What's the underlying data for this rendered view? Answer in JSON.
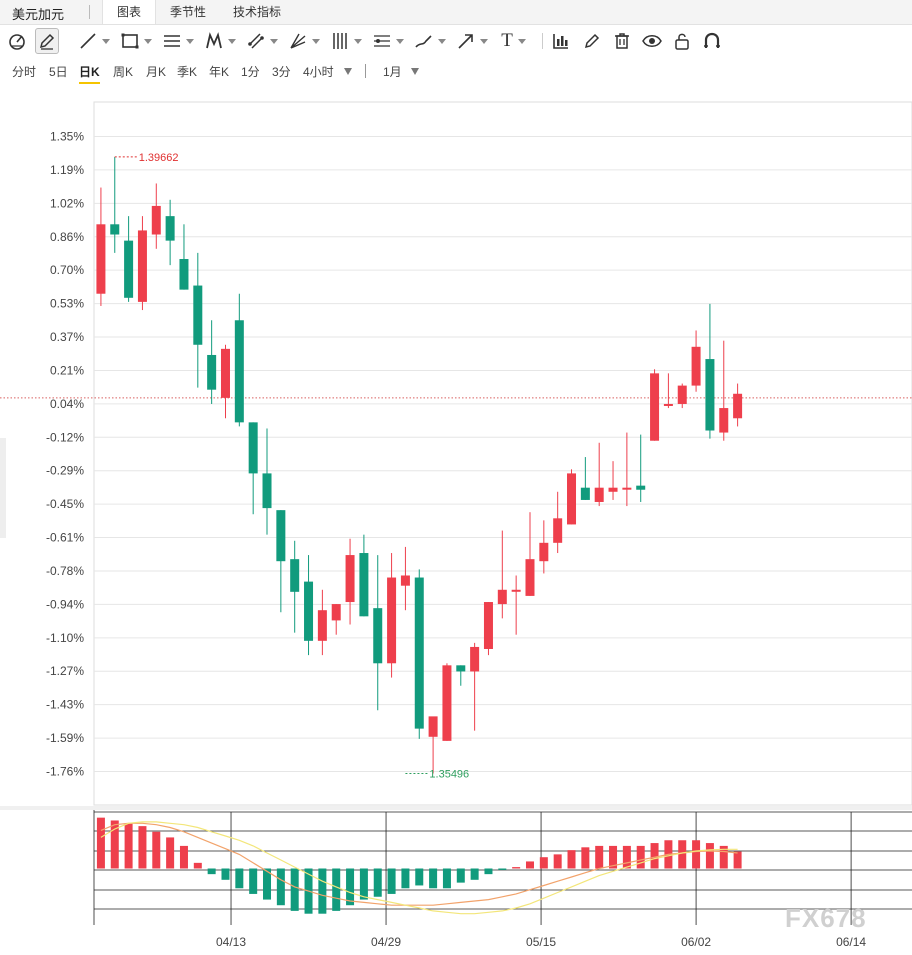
{
  "header": {
    "instrument": "美元加元",
    "tabs": [
      {
        "label": "图表",
        "active": true
      },
      {
        "label": "季节性",
        "active": false
      },
      {
        "label": "技术指标",
        "active": false
      }
    ]
  },
  "toolbar": {
    "tools": [
      {
        "icon": "cursor-icon",
        "dropdown": false
      },
      {
        "icon": "pencil-icon",
        "dropdown": false,
        "active": true
      },
      {
        "icon": "trend-line-icon",
        "dropdown": true
      },
      {
        "icon": "rectangle-icon",
        "dropdown": true
      },
      {
        "icon": "horizontal-lines-icon",
        "dropdown": true
      },
      {
        "icon": "pattern-icon",
        "dropdown": true
      },
      {
        "icon": "fib-channel-icon",
        "dropdown": true
      },
      {
        "icon": "gann-icon",
        "dropdown": true
      },
      {
        "icon": "vertical-lines-icon",
        "dropdown": true
      },
      {
        "icon": "ruler-icon",
        "dropdown": true
      },
      {
        "icon": "brush-icon",
        "dropdown": true
      },
      {
        "icon": "arrow-icon",
        "dropdown": true
      },
      {
        "icon": "text-icon",
        "dropdown": true
      },
      {
        "icon": "bar-chart-icon",
        "dropdown": false
      },
      {
        "icon": "edit-icon",
        "dropdown": false
      },
      {
        "icon": "trash-icon",
        "dropdown": false
      },
      {
        "icon": "eye-icon",
        "dropdown": false
      },
      {
        "icon": "lock-icon",
        "dropdown": false
      },
      {
        "icon": "magnet-icon",
        "dropdown": false
      }
    ],
    "text_tool_glyph": "T"
  },
  "periods": {
    "items": [
      {
        "label": "分时",
        "active": false
      },
      {
        "label": "5日",
        "active": false
      },
      {
        "label": "日K",
        "active": true
      },
      {
        "label": "周K",
        "active": false
      },
      {
        "label": "月K",
        "active": false
      },
      {
        "label": "季K",
        "active": false
      },
      {
        "label": "年K",
        "active": false
      },
      {
        "label": "1分",
        "active": false
      },
      {
        "label": "3分",
        "active": false
      },
      {
        "label": "4小时",
        "active": false
      }
    ],
    "range_label": "1月"
  },
  "watermark": "FX678",
  "colors": {
    "up": "#ee3f4c",
    "down": "#119b7d",
    "grid": "#e6e6e6",
    "macd_fast": "#f2a36b",
    "macd_slow": "#f3e67a",
    "ref_line": "#d96060"
  },
  "chart_data": [
    {
      "type": "candlestick",
      "y_axis_unit": "%",
      "y_ticks": [
        "1.35%",
        "1.19%",
        "1.02%",
        "0.86%",
        "0.70%",
        "0.53%",
        "0.37%",
        "0.21%",
        "0.04%",
        "-0.12%",
        "-0.29%",
        "-0.45%",
        "-0.61%",
        "-0.78%",
        "-0.94%",
        "-1.10%",
        "-1.27%",
        "-1.43%",
        "-1.59%",
        "-1.76%"
      ],
      "ylim": [
        -1.8,
        1.5
      ],
      "x_ticks": [
        {
          "label": "04/13",
          "index": 9.4
        },
        {
          "label": "04/29",
          "index": 20.6
        },
        {
          "label": "05/15",
          "index": 31.8
        },
        {
          "label": "06/02",
          "index": 43.0
        },
        {
          "label": "06/14",
          "index": 54.2
        }
      ],
      "x_range": [
        -0.5,
        58.6
      ],
      "reference_value": 0.07,
      "annotations": [
        {
          "text": "1.39662",
          "kind": "high",
          "index": 1,
          "value": 1.25
        },
        {
          "text": "1.35496",
          "kind": "low",
          "index": 22,
          "value": -1.77
        }
      ],
      "candles": [
        {
          "o": 0.58,
          "h": 1.1,
          "l": 0.52,
          "c": 0.92
        },
        {
          "o": 0.92,
          "h": 1.25,
          "l": 0.78,
          "c": 0.87
        },
        {
          "o": 0.84,
          "h": 0.96,
          "l": 0.54,
          "c": 0.56
        },
        {
          "o": 0.54,
          "h": 0.96,
          "l": 0.5,
          "c": 0.89
        },
        {
          "o": 0.87,
          "h": 1.12,
          "l": 0.8,
          "c": 1.01
        },
        {
          "o": 0.96,
          "h": 1.04,
          "l": 0.72,
          "c": 0.84
        },
        {
          "o": 0.75,
          "h": 0.92,
          "l": 0.6,
          "c": 0.6
        },
        {
          "o": 0.62,
          "h": 0.78,
          "l": 0.12,
          "c": 0.33
        },
        {
          "o": 0.28,
          "h": 0.45,
          "l": 0.04,
          "c": 0.11
        },
        {
          "o": 0.07,
          "h": 0.33,
          "l": -0.03,
          "c": 0.31
        },
        {
          "o": 0.45,
          "h": 0.58,
          "l": -0.07,
          "c": -0.05
        },
        {
          "o": -0.05,
          "h": -0.05,
          "l": -0.5,
          "c": -0.3
        },
        {
          "o": -0.3,
          "h": -0.08,
          "l": -0.6,
          "c": -0.47
        },
        {
          "o": -0.48,
          "h": -0.48,
          "l": -0.98,
          "c": -0.73
        },
        {
          "o": -0.72,
          "h": -0.63,
          "l": -1.08,
          "c": -0.88
        },
        {
          "o": -0.83,
          "h": -0.7,
          "l": -1.19,
          "c": -1.12
        },
        {
          "o": -1.12,
          "h": -0.87,
          "l": -1.19,
          "c": -0.97
        },
        {
          "o": -1.02,
          "h": -0.94,
          "l": -1.09,
          "c": -0.94
        },
        {
          "o": -0.93,
          "h": -0.62,
          "l": -1.04,
          "c": -0.7
        },
        {
          "o": -0.69,
          "h": -0.6,
          "l": -1.0,
          "c": -1.0
        },
        {
          "o": -0.96,
          "h": -0.7,
          "l": -1.46,
          "c": -1.23
        },
        {
          "o": -1.23,
          "h": -0.69,
          "l": -1.3,
          "c": -0.81
        },
        {
          "o": -0.85,
          "h": -0.66,
          "l": -0.97,
          "c": -0.8
        },
        {
          "o": -0.81,
          "h": -0.77,
          "l": -1.6,
          "c": -1.55
        },
        {
          "o": -1.59,
          "h": -1.5,
          "l": -1.77,
          "c": -1.49
        },
        {
          "o": -1.61,
          "h": -1.23,
          "l": -1.61,
          "c": -1.24
        },
        {
          "o": -1.24,
          "h": -1.24,
          "l": -1.34,
          "c": -1.27
        },
        {
          "o": -1.27,
          "h": -1.13,
          "l": -1.56,
          "c": -1.15
        },
        {
          "o": -1.16,
          "h": -0.93,
          "l": -1.19,
          "c": -0.93
        },
        {
          "o": -0.94,
          "h": -0.58,
          "l": -1.01,
          "c": -0.87
        },
        {
          "o": -0.87,
          "h": -0.8,
          "l": -1.09,
          "c": -0.87
        },
        {
          "o": -0.9,
          "h": -0.49,
          "l": -0.9,
          "c": -0.72
        },
        {
          "o": -0.73,
          "h": -0.53,
          "l": -0.79,
          "c": -0.64
        },
        {
          "o": -0.64,
          "h": -0.39,
          "l": -0.69,
          "c": -0.52
        },
        {
          "o": -0.55,
          "h": -0.28,
          "l": -0.55,
          "c": -0.3
        },
        {
          "o": -0.37,
          "h": -0.22,
          "l": -0.43,
          "c": -0.43
        },
        {
          "o": -0.44,
          "h": -0.15,
          "l": -0.46,
          "c": -0.37
        },
        {
          "o": -0.39,
          "h": -0.24,
          "l": -0.43,
          "c": -0.37
        },
        {
          "o": -0.37,
          "h": -0.1,
          "l": -0.46,
          "c": -0.37
        },
        {
          "o": -0.36,
          "h": -0.11,
          "l": -0.44,
          "c": -0.38
        },
        {
          "o": -0.14,
          "h": 0.21,
          "l": -0.14,
          "c": 0.19
        },
        {
          "o": 0.04,
          "h": 0.19,
          "l": 0.02,
          "c": 0.04
        },
        {
          "o": 0.04,
          "h": 0.14,
          "l": 0.02,
          "c": 0.13
        },
        {
          "o": 0.13,
          "h": 0.4,
          "l": 0.1,
          "c": 0.32
        },
        {
          "o": 0.26,
          "h": 0.53,
          "l": -0.13,
          "c": -0.09
        },
        {
          "o": -0.1,
          "h": 0.35,
          "l": -0.14,
          "c": 0.02
        },
        {
          "o": -0.03,
          "h": 0.14,
          "l": -0.07,
          "c": 0.09
        }
      ]
    },
    {
      "type": "bar",
      "indicator": "macd",
      "ylim": [
        -2.0,
        2.0
      ],
      "values": [
        1.8,
        1.7,
        1.6,
        1.5,
        1.3,
        1.1,
        0.8,
        0.2,
        -0.2,
        -0.4,
        -0.7,
        -0.9,
        -1.1,
        -1.3,
        -1.5,
        -1.6,
        -1.6,
        -1.5,
        -1.3,
        -1.1,
        -1.0,
        -0.9,
        -0.7,
        -0.6,
        -0.7,
        -0.7,
        -0.5,
        -0.4,
        -0.2,
        -0.05,
        0.05,
        0.25,
        0.4,
        0.5,
        0.65,
        0.75,
        0.8,
        0.8,
        0.8,
        0.8,
        0.9,
        1.0,
        1.0,
        1.0,
        0.9,
        0.8,
        0.6
      ],
      "series": [
        {
          "values": [
            1.35,
            1.55,
            1.6,
            1.6,
            1.55,
            1.45,
            1.3,
            1.1,
            0.9,
            0.7,
            0.5,
            0.2,
            -0.1,
            -0.4,
            -0.65,
            -0.8,
            -0.95,
            -1.05,
            -1.15,
            -1.2,
            -1.25,
            -1.3,
            -1.3,
            -1.3,
            -1.3,
            -1.25,
            -1.2,
            -1.15,
            -1.1,
            -1.0,
            -0.9,
            -0.75,
            -0.6,
            -0.45,
            -0.3,
            -0.15,
            0.0,
            0.1,
            0.2,
            0.3,
            0.4,
            0.5,
            0.55,
            0.6,
            0.62,
            0.6,
            0.55
          ]
        },
        {
          "values": [
            1.1,
            1.4,
            1.6,
            1.65,
            1.65,
            1.6,
            1.55,
            1.45,
            1.3,
            1.15,
            1.0,
            0.8,
            0.55,
            0.3,
            0.05,
            -0.2,
            -0.45,
            -0.65,
            -0.85,
            -1.0,
            -1.1,
            -1.2,
            -1.3,
            -1.4,
            -1.5,
            -1.55,
            -1.6,
            -1.6,
            -1.55,
            -1.5,
            -1.4,
            -1.25,
            -1.05,
            -0.85,
            -0.65,
            -0.45,
            -0.25,
            -0.1,
            0.05,
            0.2,
            0.35,
            0.45,
            0.55,
            0.62,
            0.66,
            0.68,
            0.68
          ]
        }
      ]
    }
  ]
}
